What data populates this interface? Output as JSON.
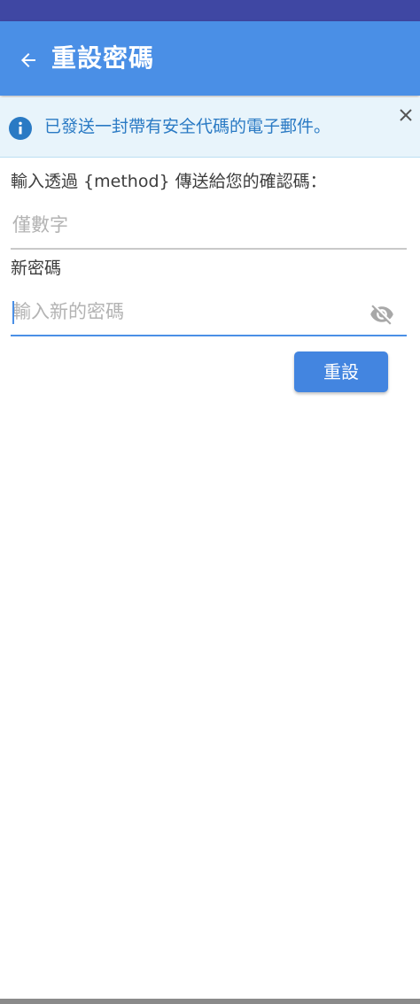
{
  "header": {
    "title": "重設密碼",
    "back_icon": "arrow-left-icon"
  },
  "banner": {
    "message": "已發送一封帶有安全代碼的電子郵件。",
    "info_icon": "info-icon",
    "close_icon": "close-icon"
  },
  "form": {
    "code_label": "輸入透過 {method} 傳送給您的確認碼：",
    "code_placeholder": "僅數字",
    "password_label": "新密碼",
    "password_placeholder": "輸入新的密碼",
    "visibility_icon": "eye-off-icon",
    "submit_label": "重設"
  },
  "colors": {
    "status_bar": "#3f47a3",
    "app_bar": "#4a8fe6",
    "banner_bg": "#e8f4fb",
    "banner_text": "#2a7ac4",
    "button": "#4385e0"
  }
}
